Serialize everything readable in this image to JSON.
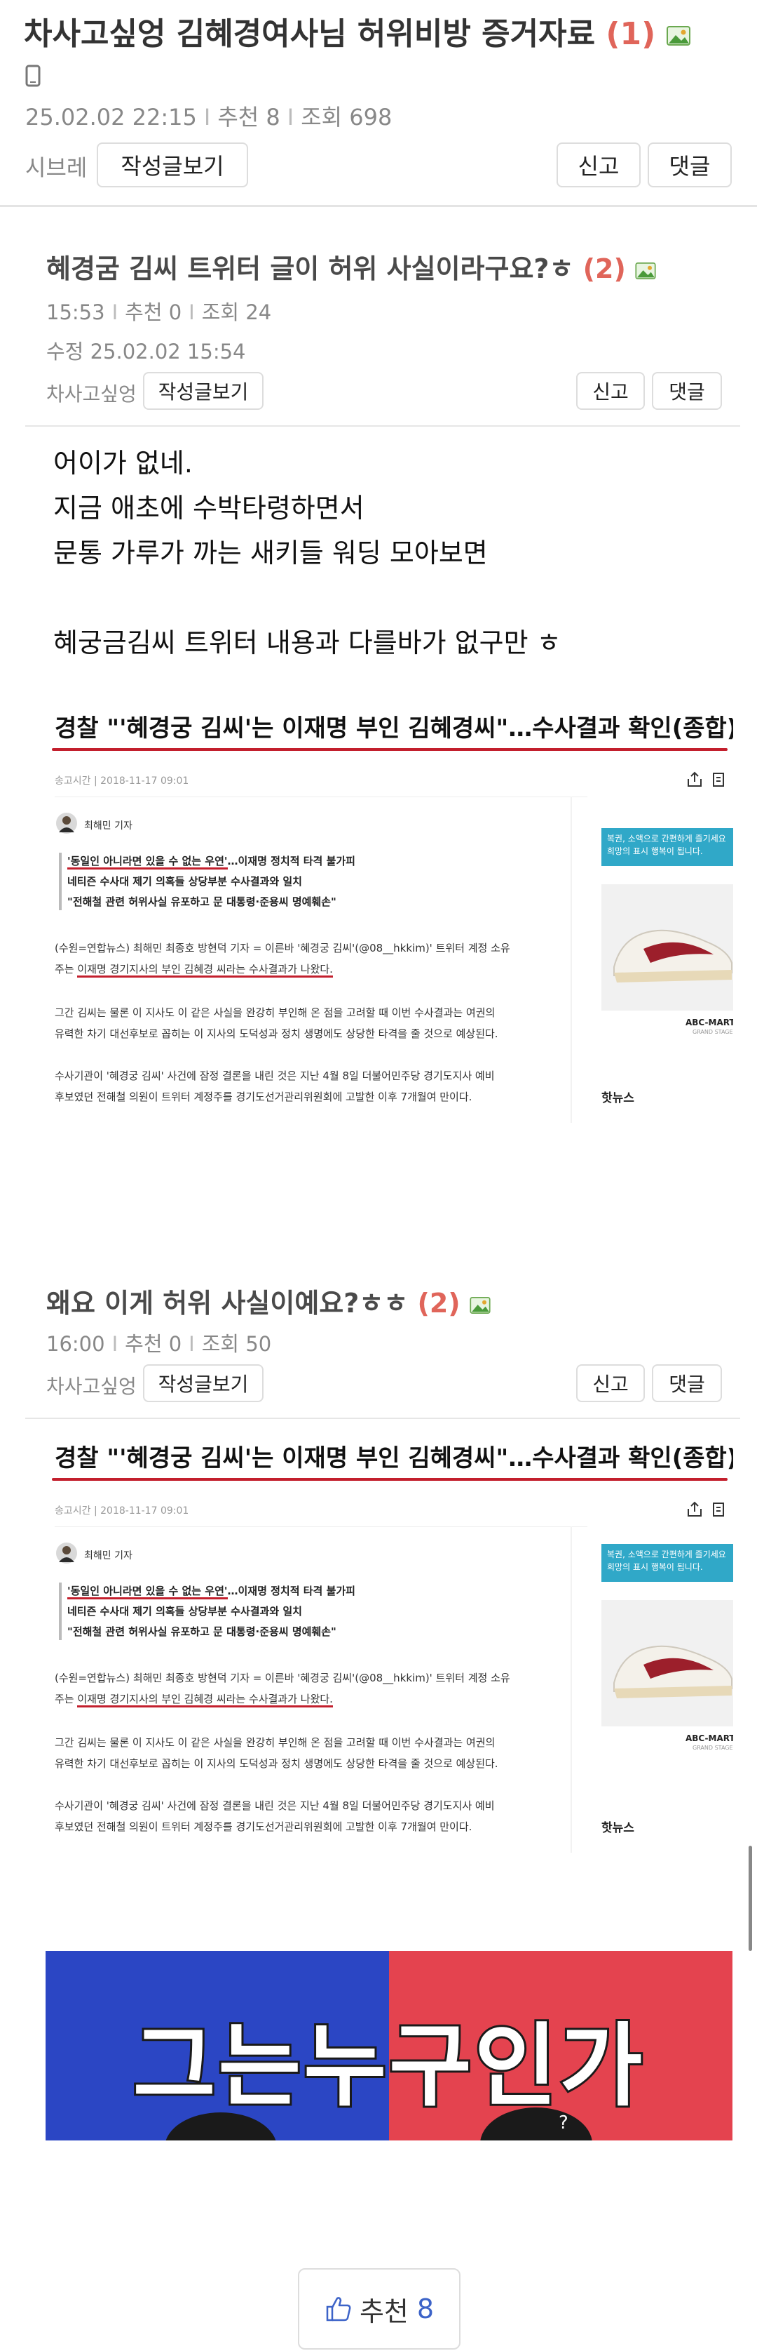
{
  "post": {
    "title": "차사고싶엉 김혜경여사님 허위비방 증거자료",
    "comment_count": "(1)",
    "date": "25.02.02  22:15",
    "recommend": "추천 8",
    "views": "조회 698",
    "author": "시브레",
    "btn_view_posts": "작성글보기",
    "btn_report": "신고",
    "btn_comment": "댓글"
  },
  "reply1": {
    "title": "혜경굼 김씨 트위터 글이 허위 사실이라구요?ㅎ",
    "comment_count": "(2)",
    "time": "15:53",
    "recommend": "추천 0",
    "views": "조회 24",
    "edited": "수정 25.02.02  15:54",
    "author": "차사고싶엉",
    "btn_view_posts": "작성글보기",
    "btn_report": "신고",
    "btn_comment": "댓글",
    "body": [
      "어이가 없네.",
      "지금 애초에 수박타령하면서",
      "문통 가루가 까는 새키들 워딩 모아보면",
      "",
      "혜궁금김씨 트위터 내용과 다를바가 없구만 ㅎ"
    ]
  },
  "news": {
    "headline": "경찰 \"'혜경궁 김씨'는 이재명 부인 김혜경씨\"…수사결과 확인(종합)",
    "timestamp": "송고시간 | 2018-11-17 09:01",
    "reporter": "최해민 기자",
    "lead1": "'동일인 아니라면 있을 수 없는 우연'",
    "lead1b": "…이재명 정치적 타격 불가피",
    "lead2": "네티즌 수사대 제기 의혹들 상당부분 수사결과와 일치",
    "lead3": "\"전해철 관련 허위사실 유포하고 문 대통령·준용씨 명예훼손\"",
    "para1a": "(수원=연합뉴스) 최해민 최종호 방현덕 기자 = 이른바 '혜경궁 김씨'(@08__hkkim)' 트위터 계정 소유",
    "para1b_pre": "주는 ",
    "para1b_hl": "이재명 경기지사의 부인 김혜경 씨라는 수사결과가 나왔다.",
    "para2a": "그간 김씨는 물론 이 지사도 이 같은 사실을 완강히 부인해 온 점을 고려할 때 이번 수사결과는 여권의",
    "para2b": "유력한 차기 대선후보로 꼽히는 이 지사의 도덕성과 정치 생명에도 상당한 타격을 줄 것으로 예상된다.",
    "para3a": "수사기관이 '혜경궁 김씨' 사건에 잠정 결론을 내린 것은 지난 4월 8일 더불어민주당 경기도지사 예비",
    "para3b": "후보였던 전해철 의원이 트위터 계정주를 경기도선거관리위원회에 고발한 이후 7개월여 만이다.",
    "ad_text": "복권, 소액으로 간편하게 즐기세요 희망의 표시 행복이 됩니다.",
    "ad_brand": "ABC-MART",
    "ad_sub": "GRAND STAGE",
    "hot_news": "핫뉴스"
  },
  "reply2": {
    "title": "왜요 이게 허위 사실이예요?ㅎㅎ",
    "comment_count": "(2)",
    "time": "16:00",
    "recommend": "추천 0",
    "views": "조회 50",
    "author": "차사고싶엉",
    "btn_view_posts": "작성글보기",
    "btn_report": "신고",
    "btn_comment": "댓글"
  },
  "poster": {
    "text": "그는누구인가",
    "colors": {
      "left": "#2b46c4",
      "right": "#e4434f"
    }
  },
  "recommend_button": {
    "label": "추천",
    "count": "8"
  },
  "colors": {
    "accent_red": "#e0655a",
    "headline_red": "#c31f2d",
    "recommend_blue": "#3c63c8"
  }
}
